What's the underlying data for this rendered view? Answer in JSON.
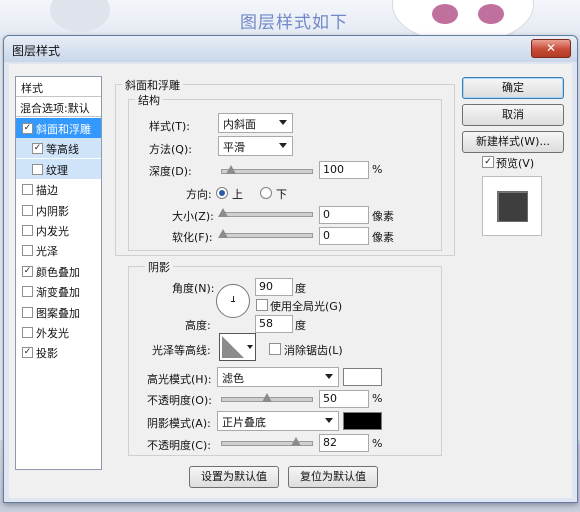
{
  "background": {
    "caption": "图层样式如下"
  },
  "dialog": {
    "title": "图层样式",
    "close_icon": "close-icon"
  },
  "style_list": {
    "header": "样式",
    "blend_options": "混合选项:默认",
    "items": [
      {
        "label": "斜面和浮雕",
        "checked": true,
        "selected": true,
        "sub": false
      },
      {
        "label": "等高线",
        "checked": true,
        "selected": false,
        "sub": true
      },
      {
        "label": "纹理",
        "checked": false,
        "selected": false,
        "sub": true
      },
      {
        "label": "描边",
        "checked": false,
        "selected": false,
        "sub": false
      },
      {
        "label": "内阴影",
        "checked": false,
        "selected": false,
        "sub": false
      },
      {
        "label": "内发光",
        "checked": false,
        "selected": false,
        "sub": false
      },
      {
        "label": "光泽",
        "checked": false,
        "selected": false,
        "sub": false
      },
      {
        "label": "颜色叠加",
        "checked": true,
        "selected": false,
        "sub": false
      },
      {
        "label": "渐变叠加",
        "checked": false,
        "selected": false,
        "sub": false
      },
      {
        "label": "图案叠加",
        "checked": false,
        "selected": false,
        "sub": false
      },
      {
        "label": "外发光",
        "checked": false,
        "selected": false,
        "sub": false
      },
      {
        "label": "投影",
        "checked": true,
        "selected": false,
        "sub": false
      }
    ]
  },
  "bevel": {
    "section_title": "斜面和浮雕",
    "structure_title": "结构",
    "style_label": "样式(T):",
    "style_value": "内斜面",
    "technique_label": "方法(Q):",
    "technique_value": "平滑",
    "depth_label": "深度(D):",
    "depth_value": "100",
    "depth_unit": "%",
    "depth_fraction": 0.1,
    "direction_label": "方向:",
    "direction_up": "上",
    "direction_down": "下",
    "size_label": "大小(Z):",
    "size_value": "0",
    "size_unit": "像素",
    "soften_label": "软化(F):",
    "soften_value": "0",
    "soften_unit": "像素"
  },
  "shading": {
    "title": "阴影",
    "angle_label": "角度(N):",
    "angle_value": "90",
    "angle_unit": "度",
    "global_light_label": "使用全局光(G)",
    "altitude_label": "高度:",
    "altitude_value": "58",
    "altitude_unit": "度",
    "gloss_label": "光泽等高线:",
    "anti_alias_label": "消除锯齿(L)",
    "highlight_mode_label": "高光模式(H):",
    "highlight_mode_value": "滤色",
    "highlight_color": "#ffffff",
    "highlight_opacity_label": "不透明度(O):",
    "highlight_opacity_value": "50",
    "highlight_opacity_fraction": 0.5,
    "shadow_mode_label": "阴影模式(A):",
    "shadow_mode_value": "正片叠底",
    "shadow_color": "#000000",
    "shadow_opacity_label": "不透明度(C):",
    "shadow_opacity_value": "82",
    "shadow_opacity_fraction": 0.82,
    "percent": "%"
  },
  "footer": {
    "make_default": "设置为默认值",
    "reset_default": "复位为默认值"
  },
  "right": {
    "ok": "确定",
    "cancel": "取消",
    "new_style": "新建样式(W)...",
    "preview": "预览(V)"
  }
}
